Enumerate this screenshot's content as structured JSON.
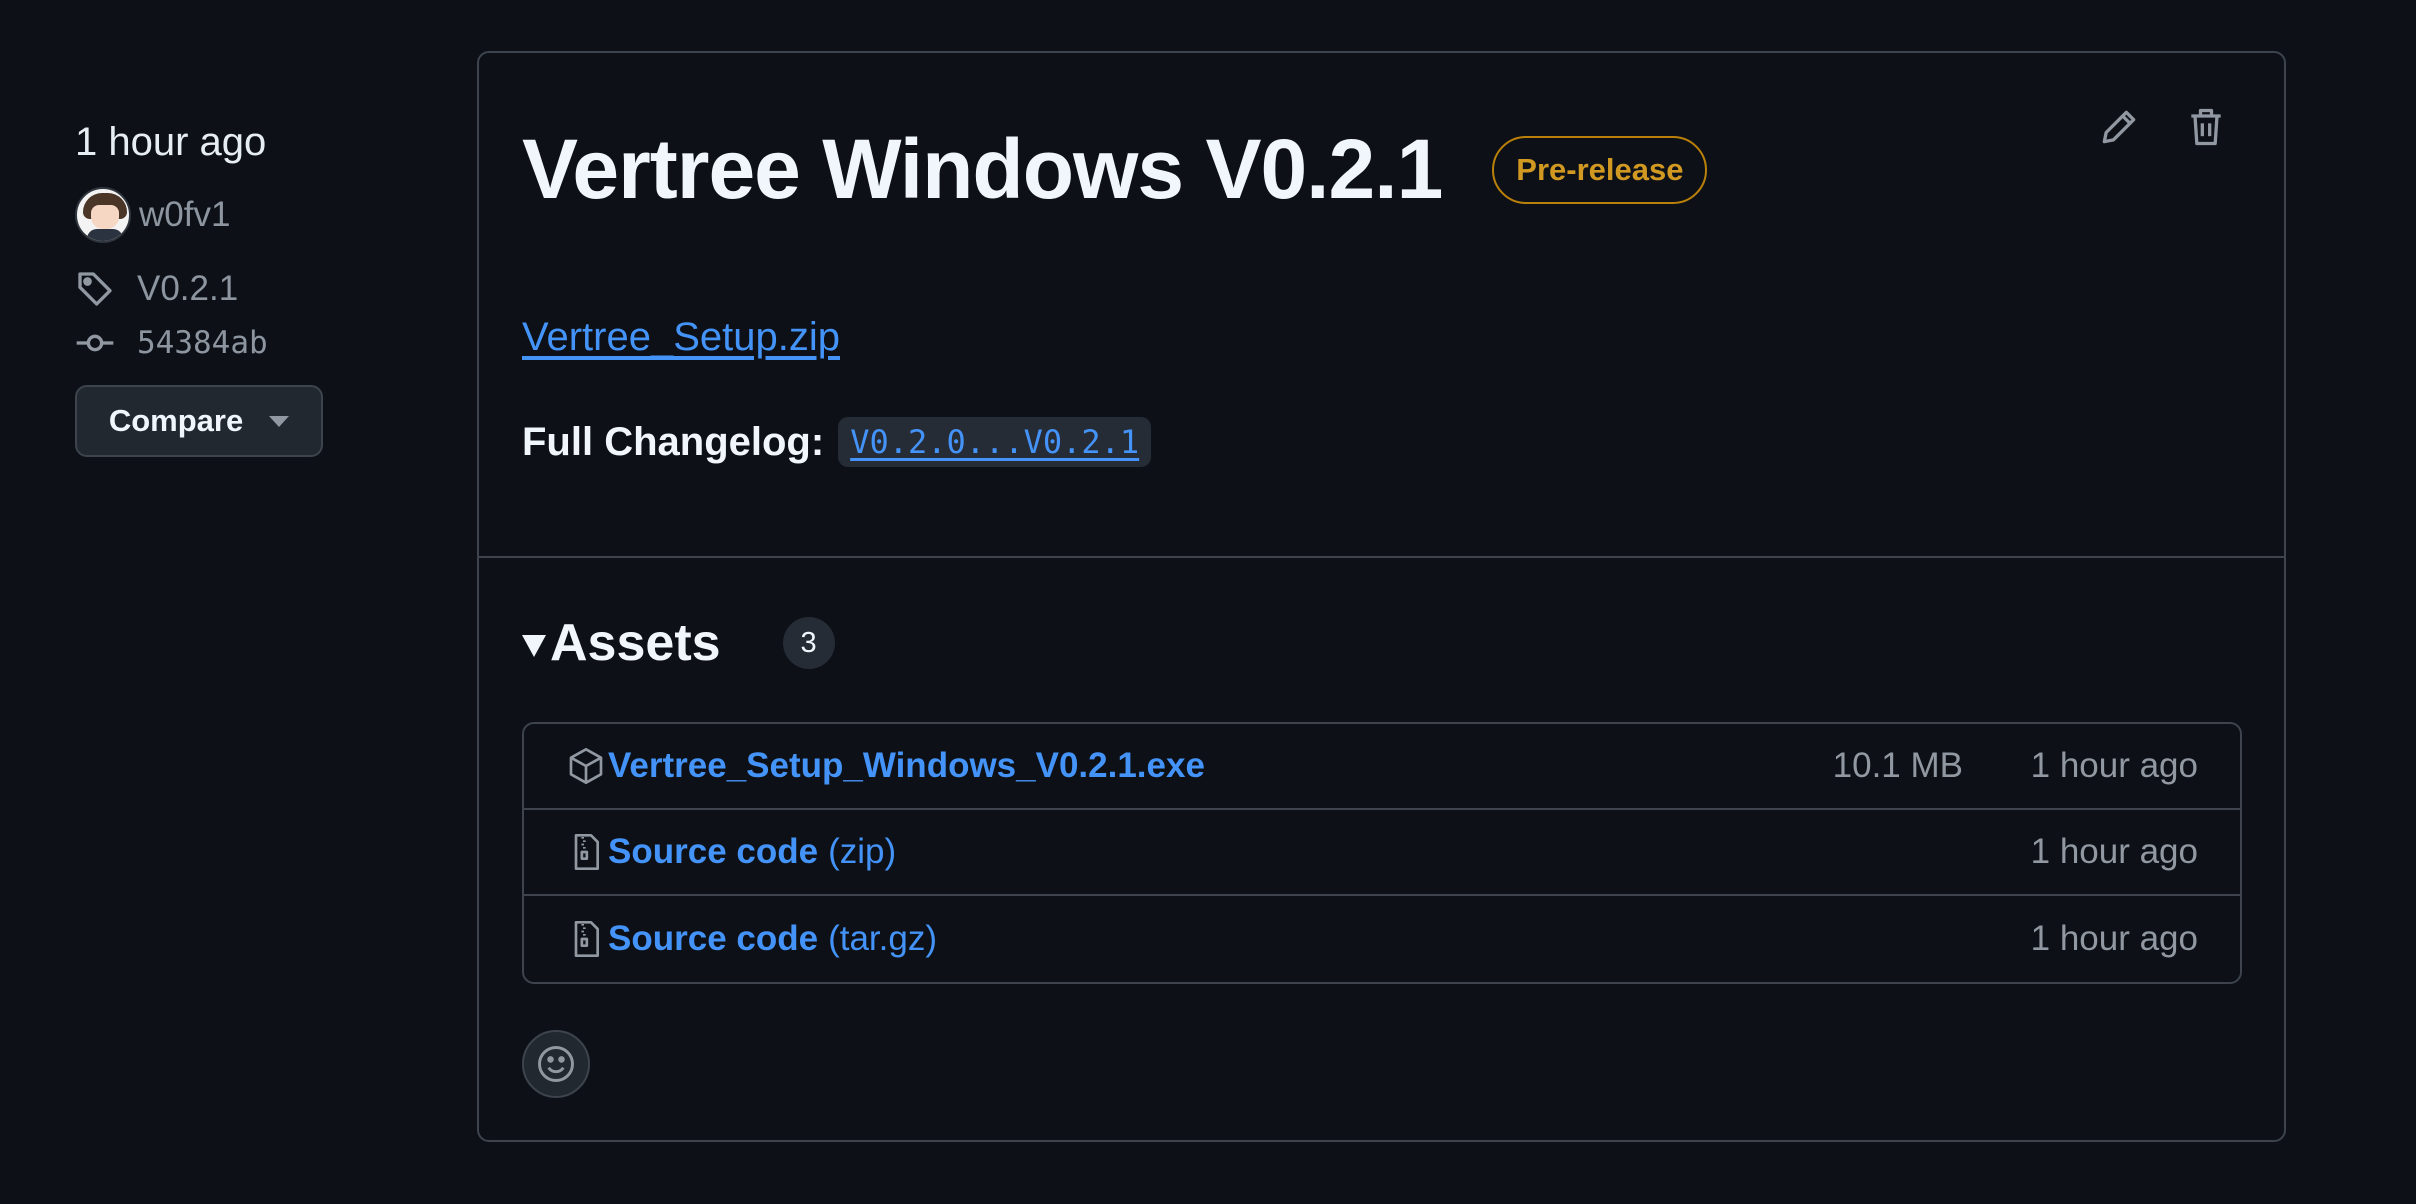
{
  "sidebar": {
    "time": "1 hour ago",
    "author": "w0fv1",
    "tag": "V0.2.1",
    "commit": "54384ab",
    "compare_label": "Compare"
  },
  "release": {
    "title": "Vertree Windows V0.2.1",
    "badge": "Pre-release",
    "attachment_link": "Vertree_Setup.zip",
    "changelog_label": "Full Changelog:",
    "changelog_range": "V0.2.0...V0.2.1"
  },
  "assets": {
    "title": "Assets",
    "count": "3",
    "items": [
      {
        "icon": "package-icon",
        "name": "Vertree_Setup_Windows_V0.2.1.exe",
        "suffix": "",
        "size": "10.1 MB",
        "time": "1 hour ago"
      },
      {
        "icon": "file-zip-icon",
        "name": "Source code",
        "suffix": "(zip)",
        "size": "",
        "time": "1 hour ago"
      },
      {
        "icon": "file-zip-icon",
        "name": "Source code",
        "suffix": "(tar.gz)",
        "size": "",
        "time": "1 hour ago"
      }
    ]
  },
  "colors": {
    "background": "#0d1117",
    "link": "#4493f8",
    "prerelease": "#d29922",
    "border": "#3d444d"
  }
}
